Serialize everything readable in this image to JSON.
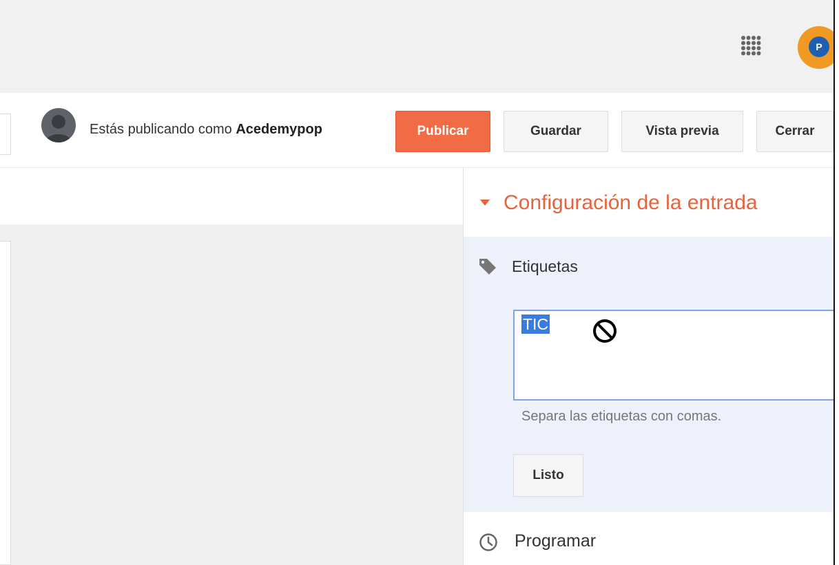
{
  "header": {
    "apps_icon": "apps-grid-icon",
    "account_initials": "P"
  },
  "toolbar": {
    "posting_as_prefix": "Estás publicando como ",
    "posting_as_user": "Acedemypop",
    "publish_label": "Publicar",
    "save_label": "Guardar",
    "preview_label": "Vista previa",
    "close_label": "Cerrar"
  },
  "settings": {
    "title": "Configuración de la entrada",
    "labels": {
      "title": "Etiquetas",
      "value": "TIC",
      "hint": "Separa las etiquetas con comas.",
      "done_label": "Listo"
    },
    "schedule": {
      "label": "Programar"
    }
  },
  "colors": {
    "accent": "#f16c44",
    "title_accent": "#e8633b",
    "panel_bg": "#ecf1fb",
    "selection": "#3a7be0"
  }
}
